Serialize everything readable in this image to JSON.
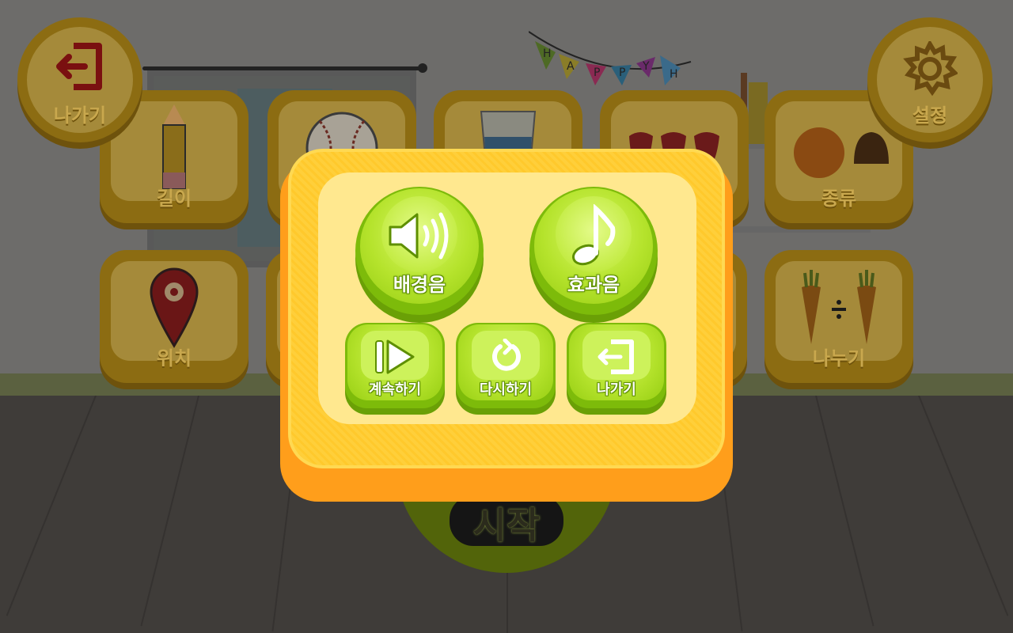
{
  "top_bar": {
    "exit_label": "나가기",
    "exit_icon": "exit-door-icon",
    "settings_label": "설정",
    "settings_icon": "gear-icon"
  },
  "background_tiles": [
    {
      "label": "길이",
      "icon": "pencil-icon"
    },
    {
      "label": "",
      "icon": "baseball-icon"
    },
    {
      "label": "",
      "icon": "glass-of-water-icon"
    },
    {
      "label": "",
      "icon": "strawberries-icon"
    },
    {
      "label": "종류",
      "icon": "orange-and-chestnut-icon"
    },
    {
      "label": "위치",
      "icon": "map-pin-icon"
    },
    {
      "label": "나누기",
      "icon": "carrots-divide-icon"
    }
  ],
  "decor": {
    "bunting_letters": [
      "H",
      "A",
      "P",
      "P",
      "Y",
      "H"
    ]
  },
  "start_button": {
    "label": "시작"
  },
  "pause_menu": {
    "bgm": {
      "label": "배경음",
      "icon": "speaker-sound-icon"
    },
    "sfx": {
      "label": "효과음",
      "icon": "music-note-icon"
    },
    "resume": {
      "label": "계속하기",
      "icon": "play-icon"
    },
    "restart": {
      "label": "다시하기",
      "icon": "restart-icon"
    },
    "exit": {
      "label": "나가기",
      "icon": "exit-icon"
    }
  },
  "colors": {
    "modal_orange": "#ffc92c",
    "modal_panel": "#ffe88f",
    "button_green": "#b5e32c",
    "dim_overlay": "#3d3b39"
  }
}
